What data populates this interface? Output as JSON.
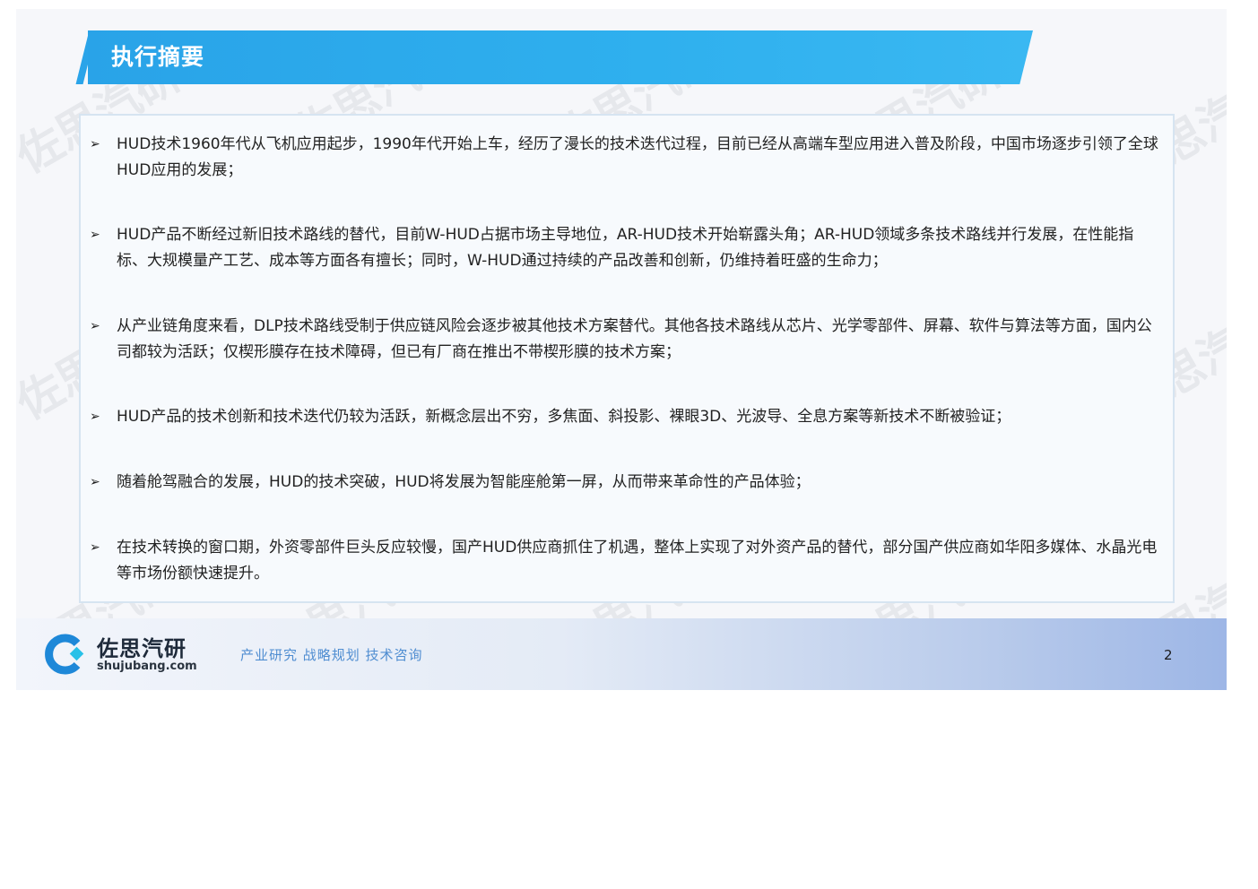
{
  "header": {
    "title": "执行摘要"
  },
  "bullets": [
    {
      "text": "HUD技术1960年代从飞机应用起步，1990年代开始上车，经历了漫长的技术迭代过程，目前已经从高端车型应用进入普及阶段，中国市场逐步引领了全球HUD应用的发展；"
    },
    {
      "text": "HUD产品不断经过新旧技术路线的替代，目前W-HUD占据市场主导地位，AR-HUD技术开始崭露头角；AR-HUD领域多条技术路线并行发展，在性能指标、大规模量产工艺、成本等方面各有擅长；同时，W-HUD通过持续的产品改善和创新，仍维持着旺盛的生命力；"
    },
    {
      "text": "从产业链角度来看，DLP技术路线受制于供应链风险会逐步被其他技术方案替代。其他各技术路线从芯片、光学零部件、屏幕、软件与算法等方面，国内公司都较为活跃；仅楔形膜存在技术障碍，但已有厂商在推出不带楔形膜的技术方案；"
    },
    {
      "text": "HUD产品的技术创新和技术迭代仍较为活跃，新概念层出不穷，多焦面、斜投影、裸眼3D、光波导、全息方案等新技术不断被验证；"
    },
    {
      "text": "随着舱驾融合的发展，HUD的技术突破，HUD将发展为智能座舱第一屏，从而带来革命性的产品体验；"
    },
    {
      "text": "在技术转换的窗口期，外资零部件巨头反应较慢，国产HUD供应商抓住了机遇，整体上实现了对外资产品的替代，部分国产供应商如华阳多媒体、水晶光电等市场份额快速提升。"
    }
  ],
  "bullet_marker": "➢",
  "footer": {
    "brand_name": "佐思汽研",
    "brand_url": "shujubang.com",
    "tagline": "产业研究 战略规划 技术咨询",
    "page_number": "2"
  },
  "watermark": {
    "text": "佐思汽研"
  },
  "colors": {
    "title_bar": "#2fabec",
    "logo_blue": "#1e88d8",
    "logo_cyan": "#28c1e8",
    "tagline": "#4f8dd1"
  }
}
